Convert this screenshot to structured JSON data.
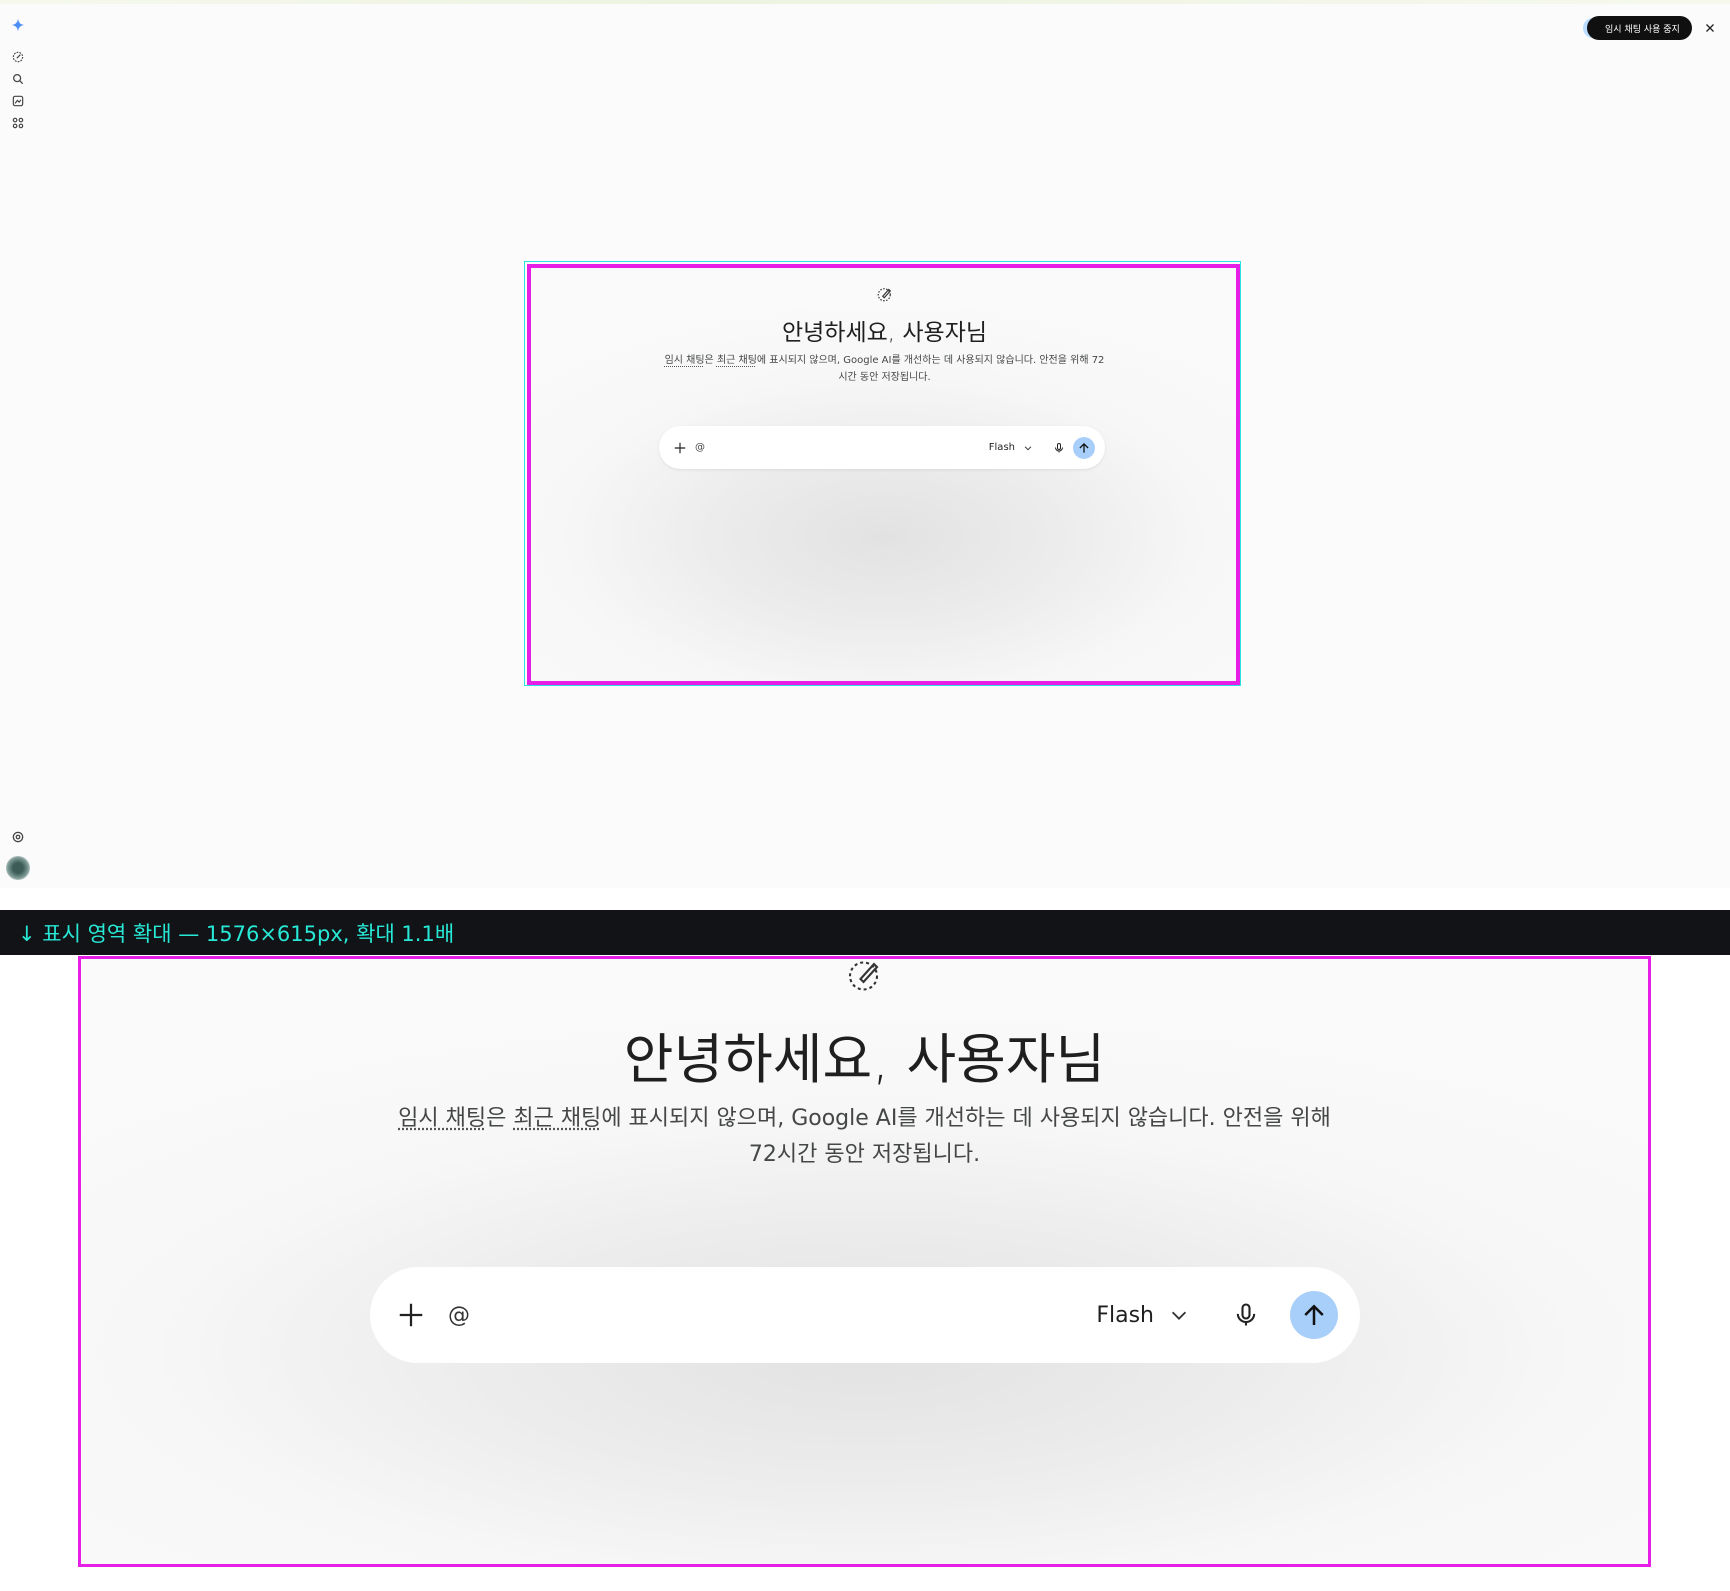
{
  "rail": {
    "items": [
      {
        "icon": "gemini-spark-icon"
      },
      {
        "icon": "new-chat-icon"
      },
      {
        "icon": "search-icon"
      },
      {
        "icon": "gallery-icon"
      },
      {
        "icon": "apps-icon"
      },
      {
        "icon": "settings-icon"
      },
      {
        "icon": "avatar"
      }
    ]
  },
  "header": {
    "temp_chat_chip": "임시 채팅 사용 중지",
    "close_icon": "close-icon"
  },
  "greeting": {
    "title": "안녕하세요, 사용자님",
    "desc_link1": "임시 채팅",
    "desc_part1": "은 ",
    "desc_link2": "최근 채팅",
    "desc_part2": "에 표시되지 않으며, Google AI를 개선하는 데 사용되지 않습니다. 안전을 위해 72시간 동안 저장됩니다."
  },
  "composer": {
    "at_symbol": "@",
    "model_label": "Flash"
  },
  "zoom_banner": "↓ 표시 영역 확대 — 1576×615px, 확대 1.1배",
  "colors": {
    "send_button": "#a8cffa",
    "selection_magenta": "#e61ee6",
    "selection_cyan": "#27e3e3",
    "banner_text": "#28e8d6"
  }
}
